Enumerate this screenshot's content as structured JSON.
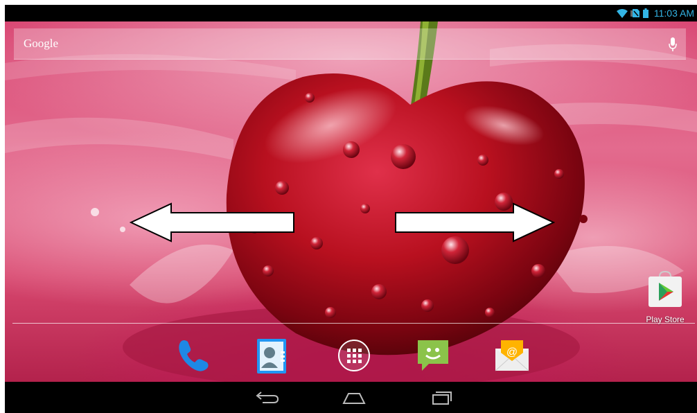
{
  "status_bar": {
    "time": "11:03 AM",
    "icons": [
      "wifi-icon",
      "no-sim-icon",
      "battery-icon"
    ],
    "accent_color": "#33b5e5"
  },
  "search": {
    "label": "Google",
    "mic_icon": "microphone-icon"
  },
  "gesture_hints": {
    "left_arrow": "arrow-left-icon",
    "right_arrow": "arrow-right-icon"
  },
  "desktop_apps": [
    {
      "label": "Play Store",
      "icon": "play-store-icon"
    }
  ],
  "dock": [
    {
      "icon": "phone-icon"
    },
    {
      "icon": "contacts-icon"
    },
    {
      "icon": "app-drawer-icon"
    },
    {
      "icon": "messaging-icon"
    },
    {
      "icon": "email-icon"
    }
  ],
  "nav_bar": {
    "buttons": [
      "back-icon",
      "home-icon",
      "recent-apps-icon"
    ]
  }
}
